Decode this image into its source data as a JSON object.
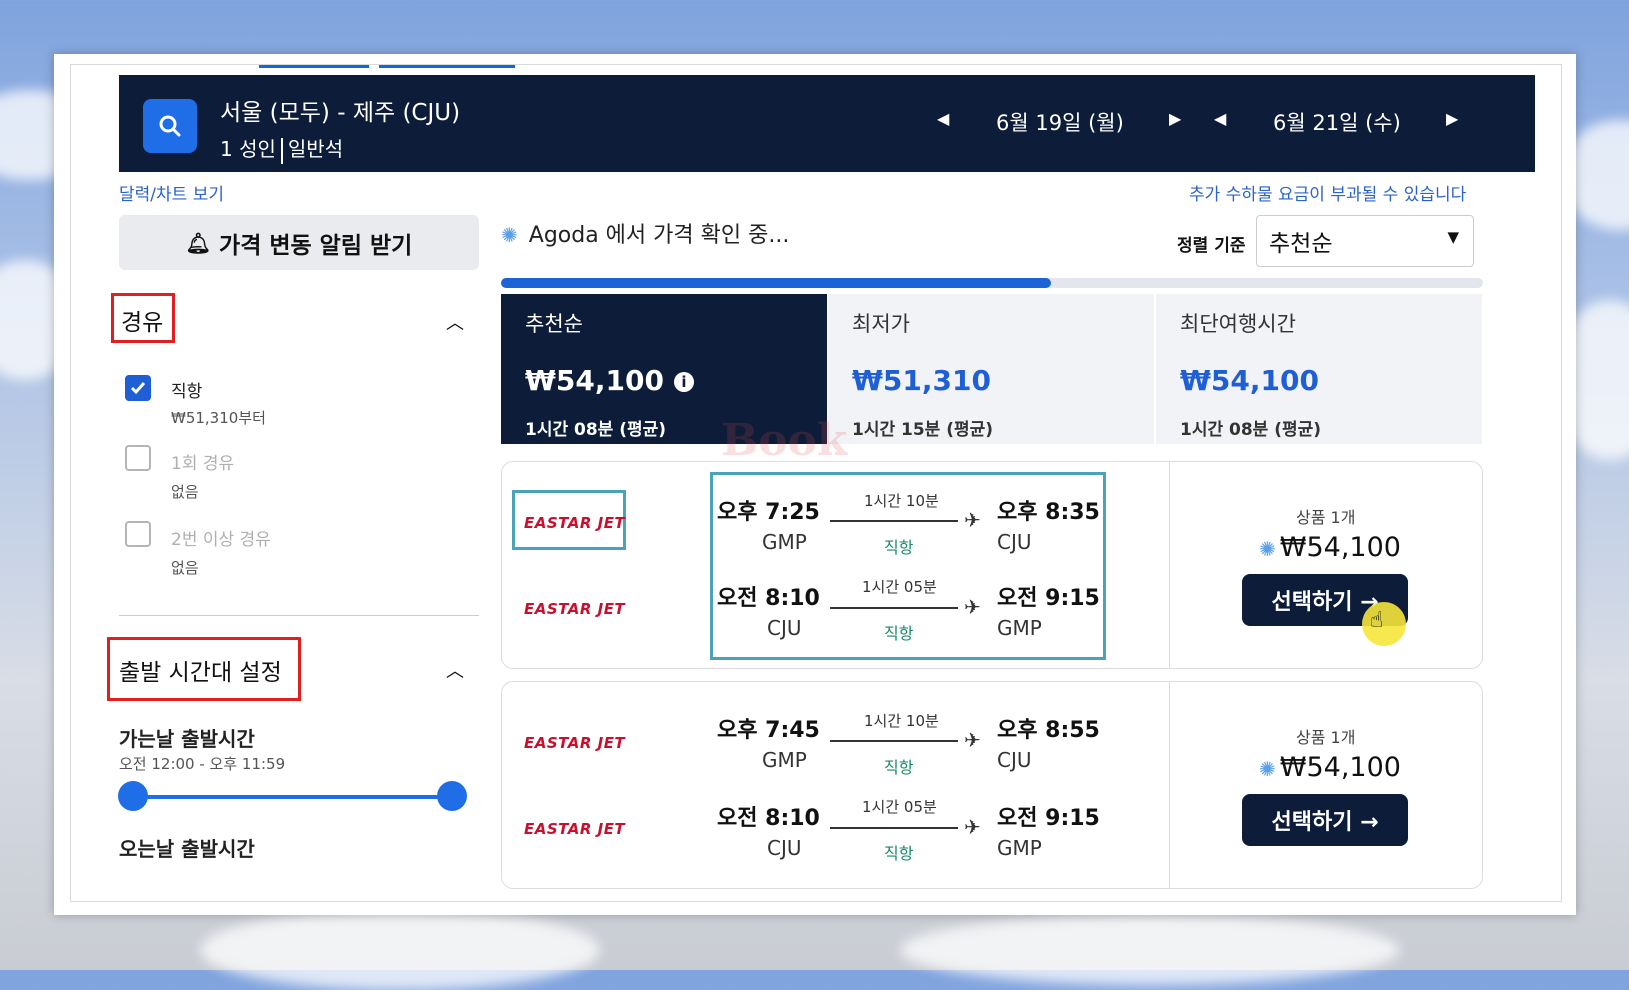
{
  "search": {
    "route": "서울 (모두) - 제주 (CJU)",
    "passengers": "1 성인",
    "cabin": "일반석",
    "depart_date": "6월 19일 (월)",
    "return_date": "6월 21일 (수)"
  },
  "links": {
    "calendar": "달력/차트 보기",
    "baggage_notice": "추가 수하물 요금이 부과될 수 있습니다"
  },
  "price_alert": "가격 변동 알림 받기",
  "filters": {
    "stops": {
      "title": "경유",
      "options": [
        {
          "label": "직항",
          "sub": "₩51,310부터",
          "checked": true
        },
        {
          "label": "1회 경유",
          "sub": "없음",
          "checked": false
        },
        {
          "label": "2번 이상 경유",
          "sub": "없음",
          "checked": false
        }
      ]
    },
    "departure_time": {
      "title": "출발 시간대 설정",
      "outbound_label": "가는날 출발시간",
      "outbound_range": "오전 12:00 - 오후 11:59",
      "return_label": "오는날 출발시간"
    }
  },
  "loading_text": "Agoda 에서 가격 확인 중...",
  "progress_fraction": 0.56,
  "sort": {
    "label": "정렬 기준",
    "selected": "추천순"
  },
  "sort_cards": [
    {
      "title": "추천순",
      "price": "₩54,100",
      "duration": "1시간 08분 (평균)"
    },
    {
      "title": "최저가",
      "price": "₩51,310",
      "duration": "1시간 15분 (평균)"
    },
    {
      "title": "최단여행시간",
      "price": "₩54,100",
      "duration": "1시간 08분 (평균)"
    }
  ],
  "results": [
    {
      "airline": "EASTAR JET",
      "legs": [
        {
          "dep_time": "오후 7:25",
          "dep_ap": "GMP",
          "duration": "1시간 10분",
          "stops": "직항",
          "arr_time": "오후 8:35",
          "arr_ap": "CJU"
        },
        {
          "dep_time": "오전 8:10",
          "dep_ap": "CJU",
          "duration": "1시간 05분",
          "stops": "직항",
          "arr_time": "오전 9:15",
          "arr_ap": "GMP"
        }
      ],
      "offers": "상품 1개",
      "price": "₩54,100",
      "button": "선택하기 →"
    },
    {
      "airline": "EASTAR JET",
      "legs": [
        {
          "dep_time": "오후 7:45",
          "dep_ap": "GMP",
          "duration": "1시간 10분",
          "stops": "직항",
          "arr_time": "오후 8:55",
          "arr_ap": "CJU"
        },
        {
          "dep_time": "오전 8:10",
          "dep_ap": "CJU",
          "duration": "1시간 05분",
          "stops": "직항",
          "arr_time": "오전 9:15",
          "arr_ap": "GMP"
        }
      ],
      "offers": "상품 1개",
      "price": "₩54,100",
      "button": "선택하기 →"
    }
  ],
  "watermark": "Book",
  "colors": {
    "navy": "#0d1c38",
    "accent_blue": "#1f6ee8",
    "highlight_red": "#e02020",
    "highlight_teal": "#4aa3b8"
  }
}
